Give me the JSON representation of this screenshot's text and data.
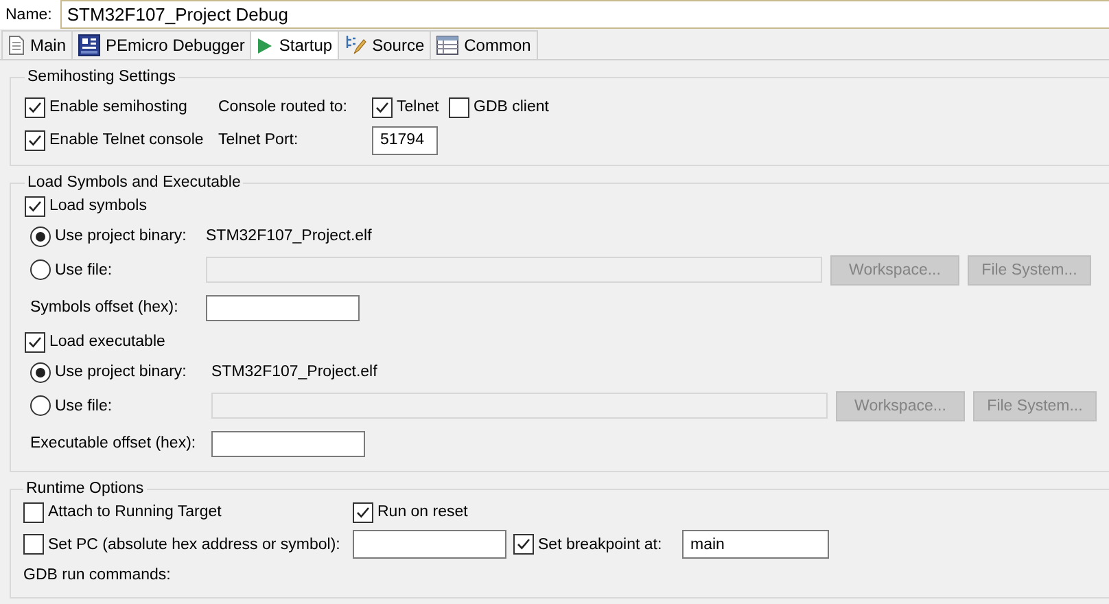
{
  "name": {
    "label": "Name:",
    "value": "STM32F107_Project Debug"
  },
  "tabs": [
    {
      "label": "Main",
      "kind": "document",
      "selected": false
    },
    {
      "label": "PEmicro Debugger",
      "kind": "chip",
      "selected": false
    },
    {
      "label": "Startup",
      "kind": "play",
      "selected": true
    },
    {
      "label": "Source",
      "kind": "source",
      "selected": false
    },
    {
      "label": "Common",
      "kind": "table",
      "selected": false
    }
  ],
  "semihosting": {
    "title": "Semihosting Settings",
    "enable_semihosting": {
      "label": "Enable semihosting",
      "checked": true
    },
    "enable_telnet": {
      "label": "Enable Telnet console",
      "checked": true
    },
    "console_label": "Console routed to:",
    "telnet": {
      "label": "Telnet",
      "checked": true
    },
    "gdb_client": {
      "label": "GDB client",
      "checked": false
    },
    "port_label": "Telnet Port:",
    "port_value": "51794"
  },
  "load": {
    "title": "Load Symbols and Executable",
    "sections": [
      {
        "toggle": {
          "label": "Load symbols",
          "checked": true
        },
        "project_binary": {
          "label": "Use project binary:",
          "selected": true,
          "value": "STM32F107_Project.elf"
        },
        "use_file": {
          "label": "Use file:",
          "selected": false
        },
        "workspace_button": {
          "label": "Workspace...",
          "disabled": true
        },
        "filesystem_button": {
          "label": "File System...",
          "disabled": true
        },
        "offset_label": "Symbols offset (hex):"
      },
      {
        "toggle": {
          "label": "Load executable",
          "checked": true
        },
        "project_binary": {
          "label": "Use project binary:",
          "selected": true,
          "value": "STM32F107_Project.elf"
        },
        "use_file": {
          "label": "Use file:",
          "selected": false
        },
        "workspace_button": {
          "label": "Workspace...",
          "disabled": true
        },
        "filesystem_button": {
          "label": "File System...",
          "disabled": true
        },
        "offset_label": "Executable offset (hex):"
      }
    ]
  },
  "runtime": {
    "title": "Runtime Options",
    "attach": {
      "label": "Attach to Running Target",
      "checked": false
    },
    "run_on_reset": {
      "label": "Run on reset",
      "checked": true
    },
    "set_pc": {
      "label": "Set PC (absolute hex address or symbol):",
      "checked": false
    },
    "breakpoint": {
      "label": "Set breakpoint at:",
      "checked": true,
      "value": "main"
    },
    "gdb_commands_label": "GDB run commands:"
  }
}
